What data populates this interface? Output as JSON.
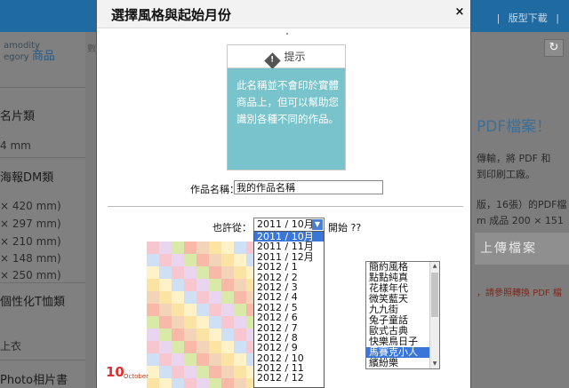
{
  "background": {
    "topbar_links": [
      "|",
      "版型下載",
      "|"
    ],
    "category_en": [
      "amodity",
      "egory"
    ],
    "category_cn": "商品",
    "left_items": [
      "名片類",
      "4 mm",
      "海報DM類",
      "× 420 mm)",
      "× 297 mm)",
      "× 210 mm)",
      "× 148 mm)",
      "× 250 mm)",
      "個性化T恤類",
      "上衣",
      "Photo相片書"
    ],
    "mid_char": "數",
    "refresh_icon": "↻",
    "right_title": "PDF檔案！",
    "right_lines": [
      "傳輸，將 PDF 和",
      "到印刷工廠。",
      "版，16張）的PDF檔",
      "m 成品 200 × 151"
    ],
    "upload_button": "上傳檔案",
    "right_note": "，請參照轉換 PDF 檔"
  },
  "modal": {
    "title": "選擇風格與起始月份",
    "close": "×",
    "tip": {
      "label": "提示",
      "icon": "!",
      "body": "此名稱並不會印於實體商品上，但可以幫助您識別各種不同的作品。"
    },
    "name_label": "作品名稱：",
    "name_value": "我的作品名稱",
    "from_label": "也許從：",
    "selected_month": "2011 / 10月",
    "start_label": "開始 ??",
    "months": [
      "2011 / 10月",
      "2011 / 11月",
      "2011 / 12月",
      "2012 / 1",
      "2012 / 2",
      "2012 / 3",
      "2012 / 4",
      "2012 / 5",
      "2012 / 6",
      "2012 / 7",
      "2012 / 8",
      "2012 / 9",
      "2012 / 10",
      "2012 / 11",
      "2012 / 12"
    ],
    "month_highlight_index": 0,
    "calendar_preview": {
      "month_number": "10",
      "month_name": "October"
    },
    "styles": [
      "簡約風格",
      "點點純真",
      "花樣年代",
      "微笑藍天",
      "九九街",
      "兔子童話",
      "歐式古典",
      "快樂鳥日子",
      "馬賽克小人",
      "繽紛樂"
    ],
    "style_selected_index": 8
  },
  "colors": {
    "tip_bg": "#79c4cc",
    "select_highlight": "#3a76d8",
    "topbar": "#1f6aa0"
  }
}
